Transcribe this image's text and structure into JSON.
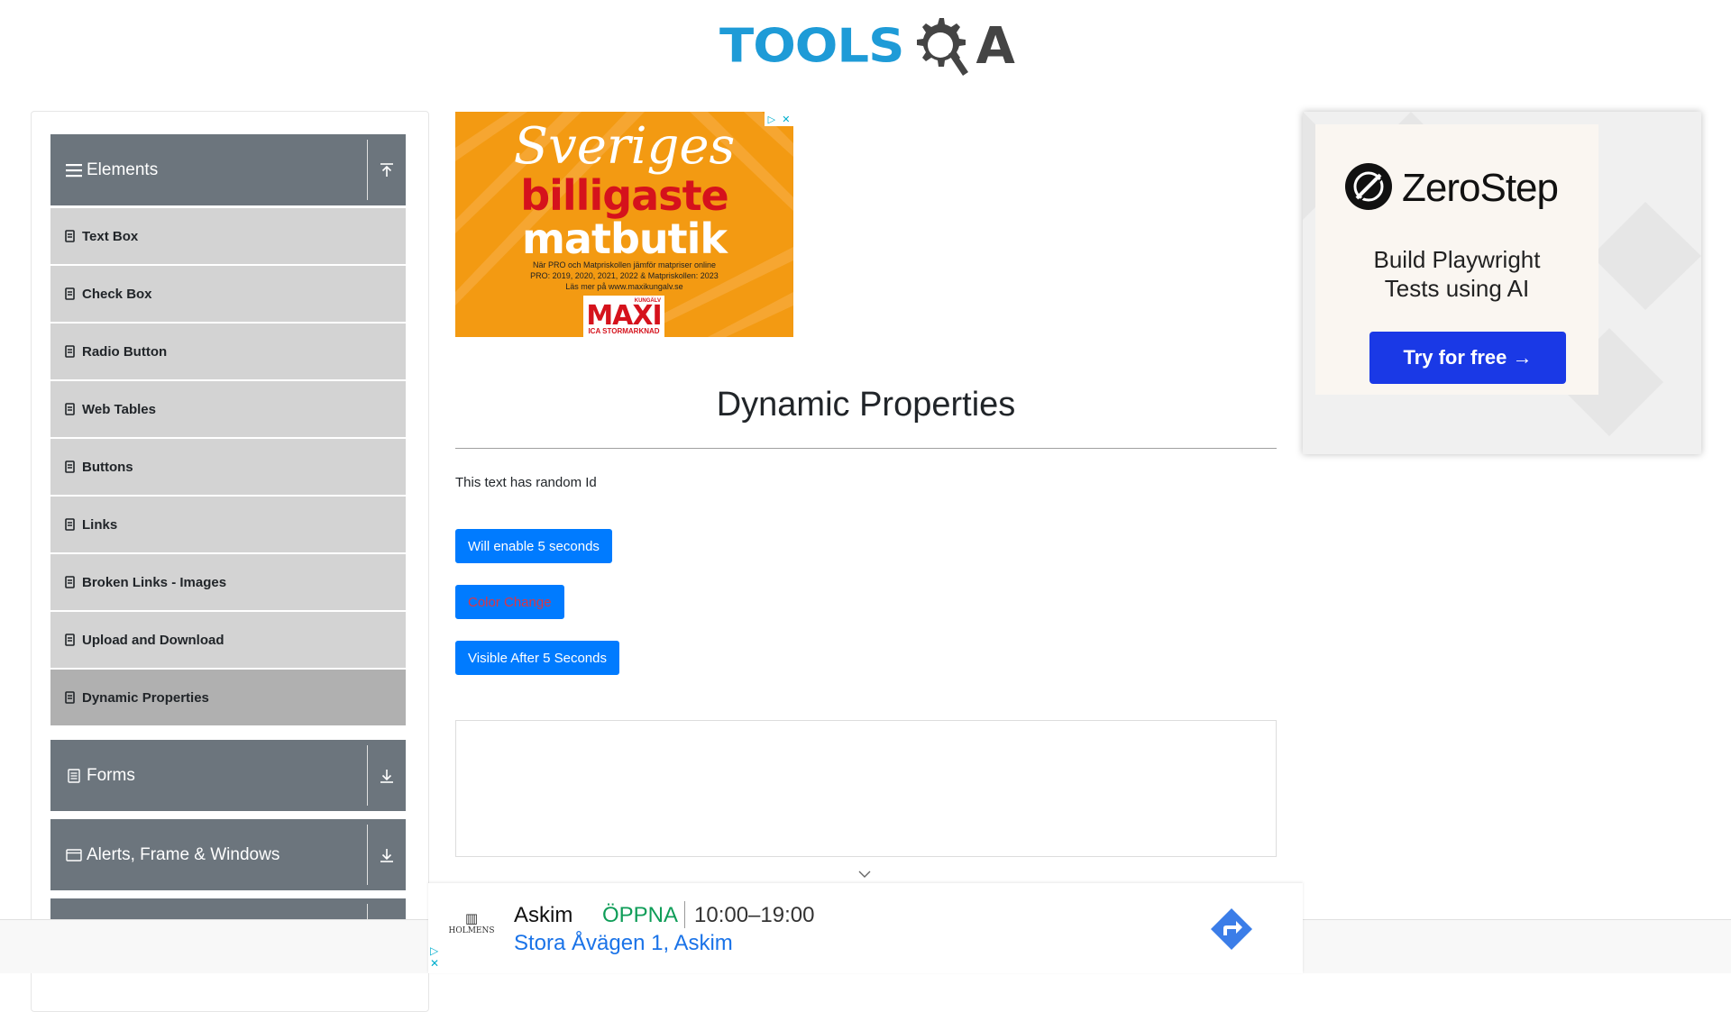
{
  "logo": {
    "tools": "TOOLS",
    "a": "A"
  },
  "sidebar": {
    "groups": [
      {
        "label": "Elements",
        "icon": "hamburger-icon",
        "toggle": "collapse-up-icon"
      },
      {
        "label": "Forms",
        "icon": "form-icon",
        "toggle": "expand-down-icon"
      },
      {
        "label": "Alerts, Frame & Windows",
        "icon": "window-icon",
        "toggle": "expand-down-icon"
      }
    ],
    "items": [
      {
        "label": "Text Box"
      },
      {
        "label": "Check Box"
      },
      {
        "label": "Radio Button"
      },
      {
        "label": "Web Tables"
      },
      {
        "label": "Buttons"
      },
      {
        "label": "Links"
      },
      {
        "label": "Broken Links - Images"
      },
      {
        "label": "Upload and Download"
      },
      {
        "label": "Dynamic Properties",
        "active": true
      }
    ]
  },
  "ad_left": {
    "line1": "Sveriges",
    "line2": "billigaste",
    "line3": "matbutik",
    "fine_print_1": "När PRO och Matpriskollen jämför matpriser online",
    "fine_print_2": "PRO: 2019, 2020, 2021, 2022 & Matpriskollen: 2023",
    "fine_print_3": "Läs mer på www.maxikungalv.se",
    "brand": "MAXI",
    "brand_sub": "ICA STORMARKNAD",
    "brand_top": "KUNGÄLV"
  },
  "main": {
    "title": "Dynamic Properties",
    "random_text": "This text has random Id",
    "buttons": {
      "enable": "Will enable 5 seconds",
      "color": "Color Change",
      "visible": "Visible After 5 Seconds"
    }
  },
  "ad_right": {
    "brand": "ZeroStep",
    "tagline_1": "Build Playwright",
    "tagline_2": "Tests using AI",
    "cta": "Try for free →"
  },
  "bottom_ad": {
    "logo_text": "HOLMENS",
    "place": "Askim",
    "status": "ÖPPNA",
    "hours": "10:00–19:00",
    "address": "Stora Åvägen 1, Askim"
  },
  "colors": {
    "nav_header": "#6c757d",
    "nav_item": "#d3d3d3",
    "nav_item_active": "#b0b0b0",
    "primary": "#007bff",
    "danger": "#dc3545",
    "logo_blue": "#1e9bd7",
    "zerostep_blue": "#1a39e6",
    "open_green": "#0f9d58",
    "ad_orange": "#f39a12"
  }
}
